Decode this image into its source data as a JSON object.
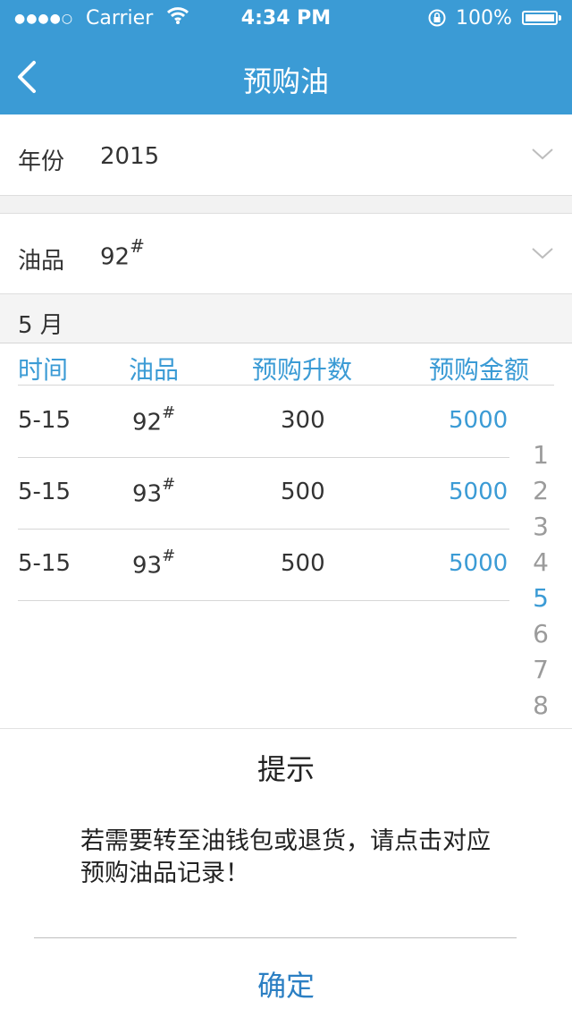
{
  "status_bar": {
    "signal": "●●●●○",
    "carrier": "Carrier",
    "time": "4:34 PM",
    "battery": "100%"
  },
  "nav": {
    "title": "预购油"
  },
  "filters": {
    "year_label": "年份",
    "year_value": "2015",
    "oil_label": "油品",
    "oil_value": "92",
    "oil_suffix": "#"
  },
  "month_header": "5 月",
  "table": {
    "headers": [
      "时间",
      "油品",
      "预购升数",
      "预购金额"
    ],
    "rows": [
      {
        "time": "5-15",
        "oil": "92",
        "suffix": "#",
        "liters": "300",
        "amount": "5000"
      },
      {
        "time": "5-15",
        "oil": "93",
        "suffix": "#",
        "liters": "500",
        "amount": "5000"
      },
      {
        "time": "5-15",
        "oil": "93",
        "suffix": "#",
        "liters": "500",
        "amount": "5000"
      }
    ]
  },
  "month_index": [
    "1",
    "2",
    "3",
    "4",
    "5",
    "6",
    "7",
    "8"
  ],
  "month_index_active": "5",
  "dialog": {
    "title": "提示",
    "message": "若需要转至油钱包或退货，请点击对应预购油品记录！",
    "confirm": "确定"
  },
  "colors": {
    "accent": "#3b9bd5",
    "button": "#2b7fc3"
  }
}
